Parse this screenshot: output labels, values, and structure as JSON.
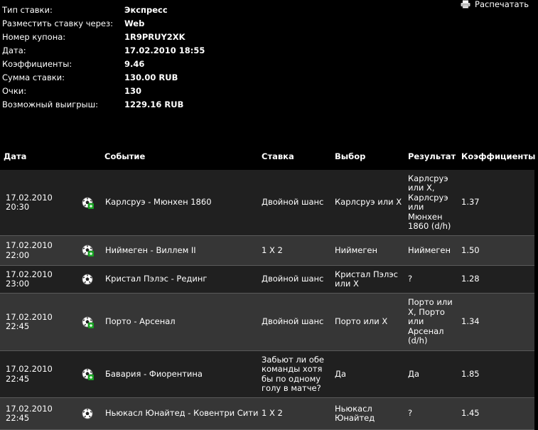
{
  "summary": {
    "rows": [
      {
        "label": "Тип ставки:",
        "value": "Экспресс"
      },
      {
        "label": "Разместить ставку через:",
        "value": "Web"
      },
      {
        "label": "Номер купона:",
        "value": "1R9PRUY2XK"
      },
      {
        "label": "Дата:",
        "value": "17.02.2010 18:55"
      },
      {
        "label": "Коэффициенты:",
        "value": "9.46"
      },
      {
        "label": "Сумма ставки:",
        "value": "130.00 RUB"
      },
      {
        "label": "Очки:",
        "value": "130"
      },
      {
        "label": "Возможный выигрыш:",
        "value": "1229.16 RUB"
      }
    ]
  },
  "print_label": "Распечатать",
  "table": {
    "headers": {
      "date": "Дата",
      "event": "Событие",
      "bet": "Ставка",
      "choice": "Выбор",
      "result": "Результат",
      "odds": "Коэффициенты"
    },
    "rows": [
      {
        "date1": "17.02.2010",
        "date2": "20:30",
        "icon": "soccer-ball-live-icon",
        "event": "Карлсруэ - Мюнхен 1860",
        "bet": "Двойной шанс",
        "choice": "Карлсруэ или Х",
        "result": "Карлсруэ или Х, Карлсруэ или Мюнхен 1860 (d/h)",
        "odds": "1.37"
      },
      {
        "date1": "17.02.2010",
        "date2": "22:00",
        "icon": "soccer-ball-live-icon",
        "event": "Ниймеген - Виллем II",
        "bet": "1 X 2",
        "choice": "Ниймеген",
        "result": "Ниймеген",
        "odds": "1.50"
      },
      {
        "date1": "17.02.2010",
        "date2": "23:00",
        "icon": "soccer-ball-icon",
        "event": "Кристал Пэлэс - Рединг",
        "bet": "Двойной шанс",
        "choice": "Кристал Пэлэс или Х",
        "result": "?",
        "odds": "1.28"
      },
      {
        "date1": "17.02.2010",
        "date2": "22:45",
        "icon": "soccer-ball-live-icon",
        "event": "Порто - Арсенал",
        "bet": "Двойной шанс",
        "choice": "Порто или Х",
        "result": "Порто или Х, Порто или Арсенал (d/h)",
        "odds": "1.34"
      },
      {
        "date1": "17.02.2010",
        "date2": "22:45",
        "icon": "soccer-ball-live-icon",
        "event": "Бавария - Фиорентина",
        "bet": "Забьют ли обе команды хотя бы по одному голу в матче?",
        "choice": "Да",
        "result": "Да",
        "odds": "1.85"
      },
      {
        "date1": "17.02.2010",
        "date2": "22:45",
        "icon": "soccer-ball-icon",
        "event": "Ньюкасл Юнайтед - Ковентри Сити",
        "bet": "1 X 2",
        "choice": "Ньюкасл Юнайтед",
        "result": "?",
        "odds": "1.45"
      }
    ]
  }
}
